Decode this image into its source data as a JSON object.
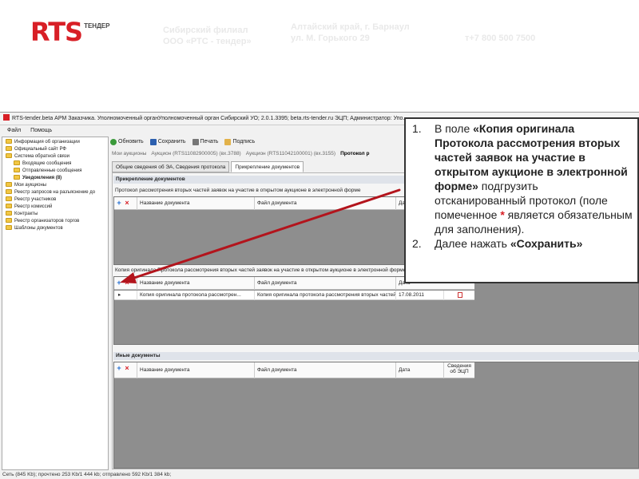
{
  "header": {
    "logo_text": "RTS",
    "logo_sub": "ТЕНДЕР",
    "branch_line1": "Сибирский филиал",
    "branch_line2": "ООО «РТС - тендер»",
    "address_line1": "Алтайский край, г. Барнаул",
    "address_line2": "ул. М. Горького 29",
    "phone": "т+7 800 500 7500"
  },
  "window": {
    "title": "RTS-tender.beta АРМ Заказчика. Уполномоченный органУполномоченный орган Сибирский УО; 2.0.1.3395; beta.rts-tender.ru ЭЦП; Администратор: Упо...",
    "menu": [
      "Файл",
      "Помощь"
    ]
  },
  "tree": {
    "items": [
      {
        "label": "Информация об организации",
        "indent": 1,
        "bold": false
      },
      {
        "label": "Официальный сайт РФ",
        "indent": 1,
        "bold": false
      },
      {
        "label": "Система обратной связи",
        "indent": 1,
        "bold": false
      },
      {
        "label": "Входящие сообщения",
        "indent": 2,
        "bold": false
      },
      {
        "label": "Отправленные сообщения",
        "indent": 2,
        "bold": false
      },
      {
        "label": "Уведомления (8)",
        "indent": 2,
        "bold": true
      },
      {
        "label": "Мои аукционы",
        "indent": 1,
        "bold": false
      },
      {
        "label": "Реестр запросов на разъяснение до",
        "indent": 1,
        "bold": false
      },
      {
        "label": "Реестр участников",
        "indent": 1,
        "bold": false
      },
      {
        "label": "Реестр комиссий",
        "indent": 1,
        "bold": false
      },
      {
        "label": "Контракты",
        "indent": 1,
        "bold": false
      },
      {
        "label": "Реестр организаторов торгов",
        "indent": 1,
        "bold": false
      },
      {
        "label": "Шаблоны документов",
        "indent": 1,
        "bold": false
      }
    ]
  },
  "toolbar": {
    "refresh": "Обновить",
    "save": "Сохранить",
    "print": "Печать",
    "sign": "Подпись"
  },
  "breadcrumbs": [
    "Мои аукционы",
    "Аукцион (RTS11082900005) (вх.3788)",
    "Аукцион (RTS11042100001) (вх.3155)",
    "Протокол р"
  ],
  "subtabs": [
    "Общие сведения об ЭА, Сведения протокола",
    "Прикрепление документов"
  ],
  "content": {
    "section_title": "Прикрепление документов",
    "grid1_label": "Протокол рассмотрения вторых частей заявок на участие в открытом аукционе в электронной форме",
    "grid2_label": "Копия оригинала Протокола рассмотрения вторых частей заявок на участие в открытом аукционе в электронной форме",
    "other_docs_title": "Иные документы",
    "columns": {
      "name": "Название документа",
      "file": "Файл документа",
      "date": "Дата",
      "ecp_line1": "Сведения",
      "ecp_line2": "об ЭЦП"
    },
    "row": {
      "marker": "▸",
      "name": "Копия оригинала протокола рассмотрен...",
      "file": "Копия оригинала протокола рассмотрения вторых частей заявок...",
      "date": "17.08.2011"
    }
  },
  "statusbar": "Сеть (845 Kb); прочтено 253 Kb/1 444 kb; отправлено 592 Kb/1 384 kb;",
  "callout": {
    "item1_num": "1.",
    "item1_pre": "В поле ",
    "item1_bold": "«Копия оригинала Протокола рассмотрения вторых частей заявок на участие в открытом аукционе в электронной форме»",
    "item1_post": " подгрузить отсканированный протокол ",
    "item1_note_pre": "(поле помеченное ",
    "item1_star": "*",
    "item1_note_post": " является обязательным для заполнения).",
    "item2_num": "2.",
    "item2_pre": " Далее нажать ",
    "item2_bold": "«Сохранить»"
  },
  "colors": {
    "brand_red": "#d81f26",
    "arrow": "#b3141c"
  }
}
